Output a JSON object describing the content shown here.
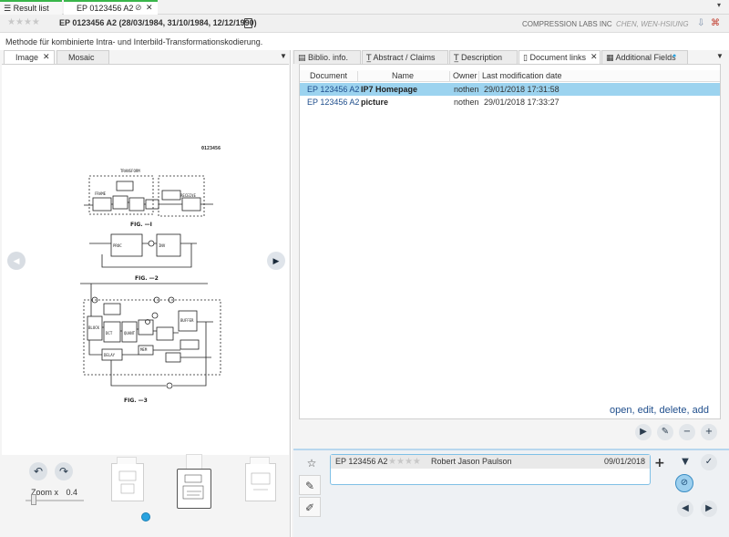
{
  "top_tabs": {
    "result_list": "Result list",
    "document": "EP 0123456 A2"
  },
  "header": {
    "title": "EP 0123456 A2 (28/03/1984, 31/10/1984, 12/12/1990)",
    "company": "COMPRESSION LABS INC",
    "inventor": "CHEN, WEN-HSIUNG",
    "rating": 0
  },
  "subtitle": "Methode für kombinierte Intra- und Interbild-Transformationskodierung.",
  "left_panel": {
    "tabs": [
      "Image",
      "Mosaic"
    ],
    "drawing": {
      "number": "0123456",
      "fig1": "FIG. —I",
      "fig2": "FIG. —2",
      "fig3": "FIG. —3"
    },
    "zoom_label": "Zoom x",
    "zoom_value": "0.4",
    "page_fraction": 0.1
  },
  "right_panel": {
    "tabs": [
      "Biblio. info.",
      "Abstract / Claims",
      "Description",
      "Document links",
      "Additional Fields"
    ],
    "columns": [
      "Document",
      "Name",
      "Owner",
      "Last modification date"
    ],
    "rows": [
      {
        "document": "EP 123456 A2",
        "name": "IP7 Homepage",
        "owner": "nothen",
        "date": "29/01/2018 17:31:58"
      },
      {
        "document": "EP 123456 A2",
        "name": "picture",
        "owner": "nothen",
        "date": "29/01/2018 17:33:27"
      }
    ],
    "actions": {
      "open": "open",
      "edit": "edit",
      "delete": "delete",
      "add": "add",
      "separator": ","
    }
  },
  "notes": {
    "document": "EP 123456 A2",
    "author": "Robert Jason Paulson",
    "date": "09/01/2018",
    "rating": 0
  },
  "colors": {
    "accent_green": "#39b54a",
    "selection_blue": "#9cd3ef",
    "link_blue": "#1f4e8c",
    "highlight_blue": "#29a3e0"
  }
}
